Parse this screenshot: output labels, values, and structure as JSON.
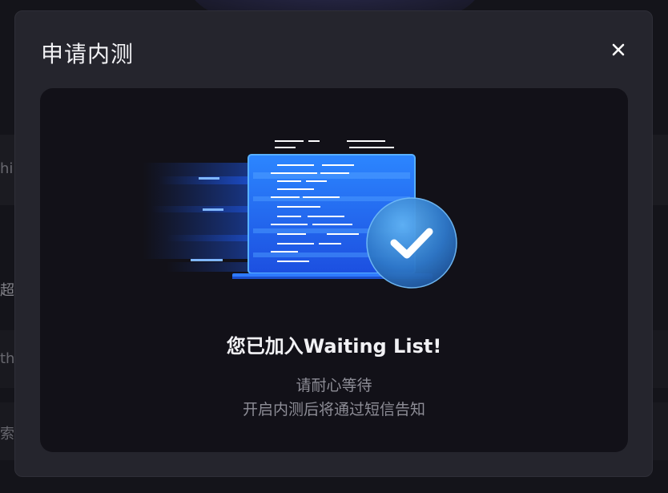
{
  "modal": {
    "title": "申请内测",
    "close_label": "×"
  },
  "result": {
    "title": "您已加入Waiting List!",
    "line1": "请耐心等待",
    "line2": "开启内测后将通过短信告知"
  },
  "background": {
    "text1": "hi",
    "text2": "超",
    "text3": "th",
    "text4": "索"
  },
  "colors": {
    "modal_bg": "#25252d",
    "panel_bg": "#121118",
    "accent_blue": "#2f7bff",
    "check_badge": "#3a8fe0"
  },
  "icons": {
    "close": "close-icon",
    "check": "check-circle-icon",
    "illustration": "laptop-code-illustration"
  }
}
